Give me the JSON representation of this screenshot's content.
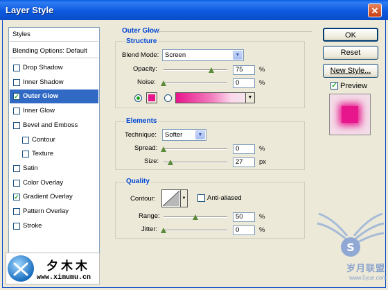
{
  "window": {
    "title": "Layer Style",
    "close_glyph": "✕"
  },
  "sidebar": {
    "header": "Styles",
    "blending": "Blending Options: Default",
    "items": [
      {
        "label": "Drop Shadow",
        "checked": false
      },
      {
        "label": "Inner Shadow",
        "checked": false
      },
      {
        "label": "Outer Glow",
        "checked": true,
        "selected": true
      },
      {
        "label": "Inner Glow",
        "checked": false
      },
      {
        "label": "Bevel and Emboss",
        "checked": false
      },
      {
        "label": "Contour",
        "checked": false,
        "indent": true
      },
      {
        "label": "Texture",
        "checked": false,
        "indent": true
      },
      {
        "label": "Satin",
        "checked": false
      },
      {
        "label": "Color Overlay",
        "checked": false
      },
      {
        "label": "Gradient Overlay",
        "checked": true
      },
      {
        "label": "Pattern Overlay",
        "checked": false
      },
      {
        "label": "Stroke",
        "checked": false
      }
    ],
    "check_glyph": "✓"
  },
  "outer_glow": {
    "title": "Outer Glow",
    "structure": {
      "title": "Structure",
      "blend_mode_label": "Blend Mode:",
      "blend_mode_value": "Screen",
      "opacity_label": "Opacity:",
      "opacity_value": "75",
      "opacity_level": 0.75,
      "noise_label": "Noise:",
      "noise_value": "0",
      "noise_level": 0,
      "pct": "%",
      "color": "#e8168c"
    },
    "elements": {
      "title": "Elements",
      "technique_label": "Technique:",
      "technique_value": "Softer",
      "spread_label": "Spread:",
      "spread_value": "0",
      "spread_level": 0,
      "size_label": "Size:",
      "size_value": "27",
      "size_level": 0.11,
      "pct": "%",
      "px": "px"
    },
    "quality": {
      "title": "Quality",
      "contour_label": "Contour:",
      "anti_aliased_label": "Anti-aliased",
      "anti_aliased": false,
      "range_label": "Range:",
      "range_value": "50",
      "range_level": 0.5,
      "jitter_label": "Jitter:",
      "jitter_value": "0",
      "jitter_level": 0,
      "pct": "%"
    }
  },
  "buttons": {
    "ok": "OK",
    "reset": "Reset",
    "new_style": "New Style...",
    "preview_label": "Preview",
    "preview_checked": true
  },
  "watermarks": {
    "left_text": "夕木木",
    "left_url": "www.ximumu.cn",
    "right_text": "岁月联盟",
    "right_url": "www.5yue.com"
  },
  "colors": {
    "accent": "#316ac5",
    "glow": "#e8168c"
  }
}
